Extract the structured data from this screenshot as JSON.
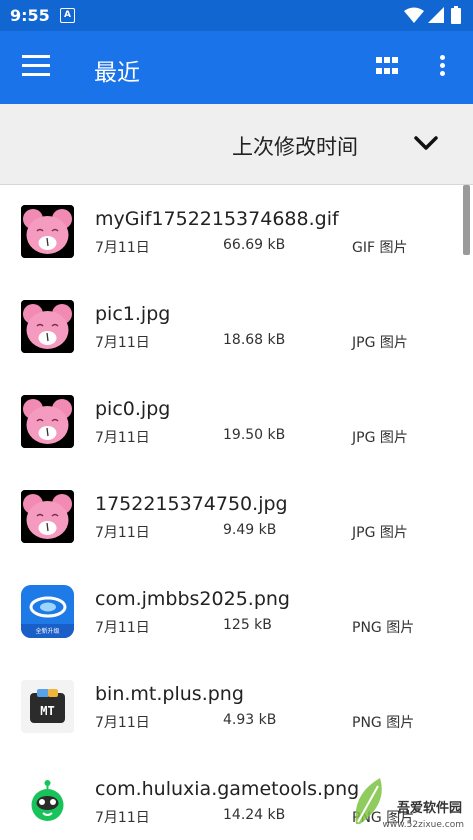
{
  "status_bar": {
    "time": "9:55"
  },
  "app_bar": {
    "title": "最近"
  },
  "sort": {
    "label": "上次修改时间"
  },
  "files": [
    {
      "name": "myGif1752215374688.gif",
      "date": "7月11日",
      "size": "66.69 kB",
      "type": "GIF 图片",
      "thumb": "pink-mouse"
    },
    {
      "name": "pic1.jpg",
      "date": "7月11日",
      "size": "18.68 kB",
      "type": "JPG 图片",
      "thumb": "pink-mouse"
    },
    {
      "name": "pic0.jpg",
      "date": "7月11日",
      "size": "19.50 kB",
      "type": "JPG 图片",
      "thumb": "pink-mouse"
    },
    {
      "name": "1752215374750.jpg",
      "date": "7月11日",
      "size": "9.49 kB",
      "type": "JPG 图片",
      "thumb": "pink-mouse"
    },
    {
      "name": "com.jmbbs2025.png",
      "date": "7月11日",
      "size": "125 kB",
      "type": "PNG 图片",
      "thumb": "blue-app-icon",
      "thumb_caption": "全新升级"
    },
    {
      "name": "bin.mt.plus.png",
      "date": "7月11日",
      "size": "4.93 kB",
      "type": "PNG 图片",
      "thumb": "mt-app-icon",
      "thumb_caption": "MT"
    },
    {
      "name": "com.huluxia.gametools.png",
      "date": "7月11日",
      "size": "14.24 kB",
      "type": "PNG 图片",
      "thumb": "green-alien-icon"
    }
  ],
  "watermark": {
    "text": "吾爱软件园",
    "url": "www.52zixue.com"
  },
  "colors": {
    "status_bar": "#1266d1",
    "app_bar": "#1a73e8",
    "sort_bar": "#efefef"
  }
}
